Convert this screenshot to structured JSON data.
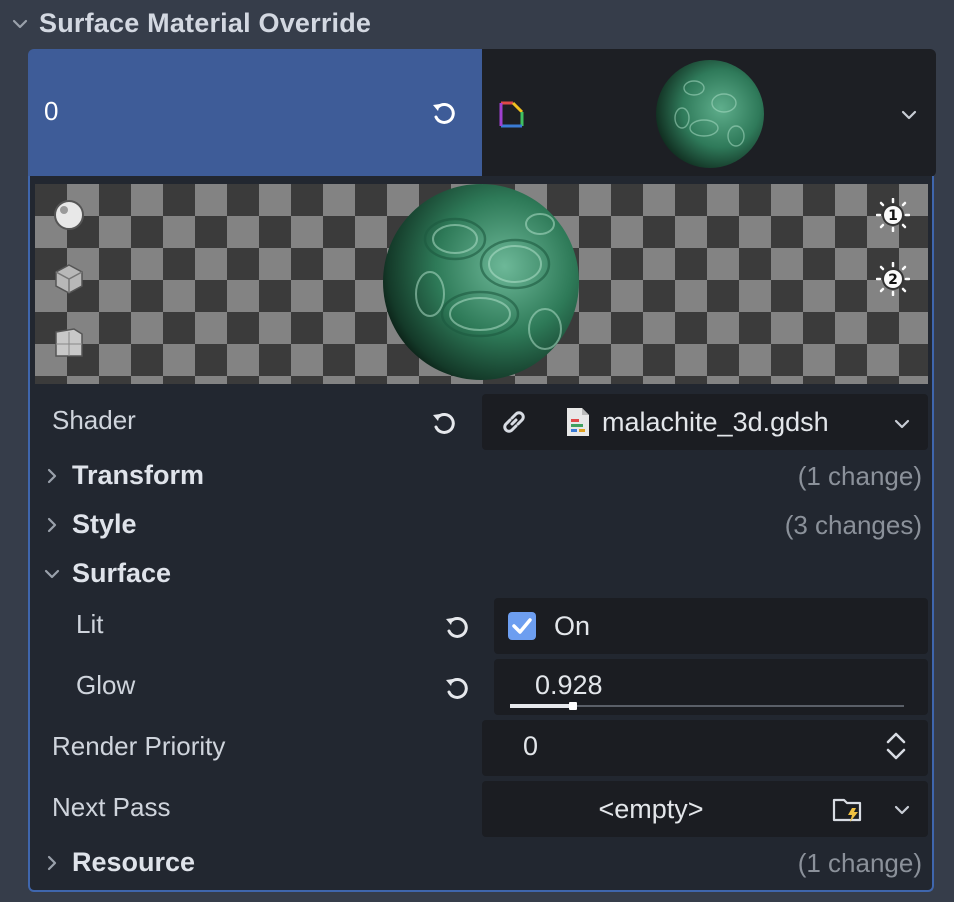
{
  "section": {
    "title": "Surface Material Override"
  },
  "slot": {
    "index": "0"
  },
  "shader": {
    "label": "Shader",
    "file": "malachite_3d.gdsh"
  },
  "groups": {
    "transform": {
      "label": "Transform",
      "changes": "(1 change)"
    },
    "style": {
      "label": "Style",
      "changes": "(3 changes)"
    },
    "surface": {
      "label": "Surface"
    },
    "resource": {
      "label": "Resource",
      "changes": "(1 change)"
    }
  },
  "params": {
    "lit": {
      "label": "Lit",
      "value": "On",
      "checked": true
    },
    "glow": {
      "label": "Glow",
      "value": "0.928",
      "fraction": 0.16
    }
  },
  "render_priority": {
    "label": "Render Priority",
    "value": "0"
  },
  "next_pass": {
    "label": "Next Pass",
    "value": "<empty>"
  },
  "colors": {
    "accent": "#3e5c98",
    "border": "#3f66ad",
    "panel": "#222730",
    "field": "#1b1d22",
    "malachite": "#2f7a5a",
    "checkbox": "#6d9ef0"
  },
  "icons": {
    "preview_light": [
      "sphere-icon",
      "cube-icon",
      "plane-icon"
    ],
    "lights": [
      "light1-icon",
      "light2-icon"
    ]
  }
}
